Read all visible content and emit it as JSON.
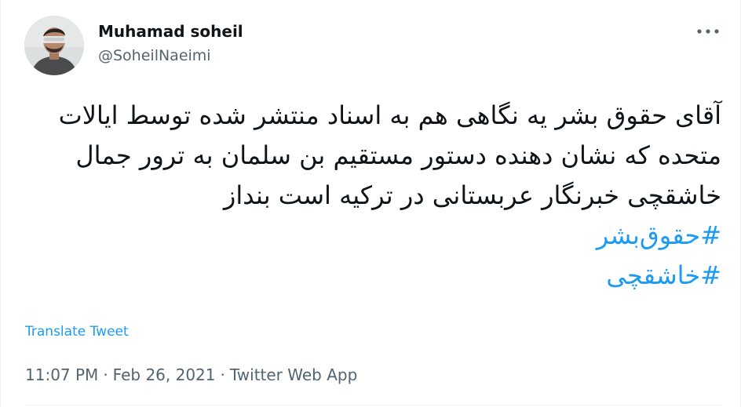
{
  "author": {
    "display_name": "Muhamad soheil",
    "handle": "@SoheilNaeimi"
  },
  "tweet": {
    "text": "آقای حقوق بشر یه نگاهی هم به اسناد منتشر شده توسط ایالات متحده  که نشان دهنده دستور مستقیم بن سلمان به ترور جمال خاشقچی خبرنگار عربستانی در ترکیه است بنداز",
    "hashtags": [
      "#حقوق‌بشر",
      "#خاشقچی"
    ]
  },
  "actions": {
    "translate_label": "Translate Tweet",
    "more_icon": "more-horizontal-icon"
  },
  "meta": {
    "time": "11:07 PM",
    "separator": "·",
    "date": "Feb 26, 2021",
    "source": "Twitter Web App"
  },
  "colors": {
    "link": "#1d9bf0",
    "secondary_text": "#536471",
    "primary_text": "#0f1419"
  }
}
